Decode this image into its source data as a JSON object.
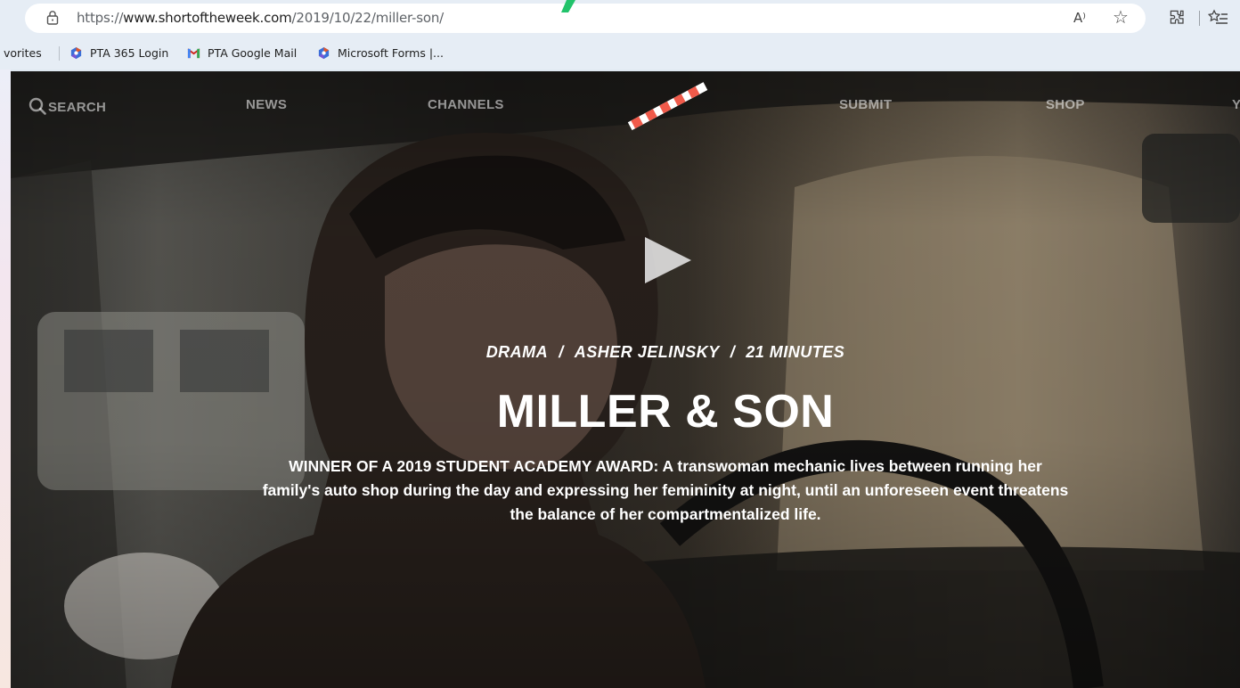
{
  "browser": {
    "url_scheme": "https://",
    "url_host": "www.shortoftheweek.com",
    "url_path": "/2019/10/22/miller-son/",
    "read_aloud_label": "A⁾",
    "favorites": [
      {
        "label": "vorites"
      },
      {
        "label": "PTA 365 Login",
        "icon": "office-icon"
      },
      {
        "label": "PTA Google Mail",
        "icon": "gmail-icon"
      },
      {
        "label": "Microsoft Forms |...",
        "icon": "office-icon"
      }
    ]
  },
  "site_nav": {
    "search": "SEARCH",
    "news": "NEWS",
    "channels": "CHANNELS",
    "submit": "SUBMIT",
    "shop": "SHOP",
    "cut_off": "Y"
  },
  "film": {
    "genre": "DRAMA",
    "director": "ASHER JELINSKY",
    "duration": "21 MINUTES",
    "separator": "/",
    "title": "MILLER & SON",
    "description": "WINNER OF A 2019 STUDENT ACADEMY AWARD: A transwoman mechanic lives between running her family's auto shop during the day and expressing her femininity at night, until an unforeseen event threatens the balance of her compartmentalized life."
  },
  "colors": {
    "browser_chrome": "#e6edf5",
    "accent_green": "#21c36b",
    "logo_stripe_red": "#f05a4a",
    "nav_text": "rgba(255,255,255,0.55)"
  }
}
